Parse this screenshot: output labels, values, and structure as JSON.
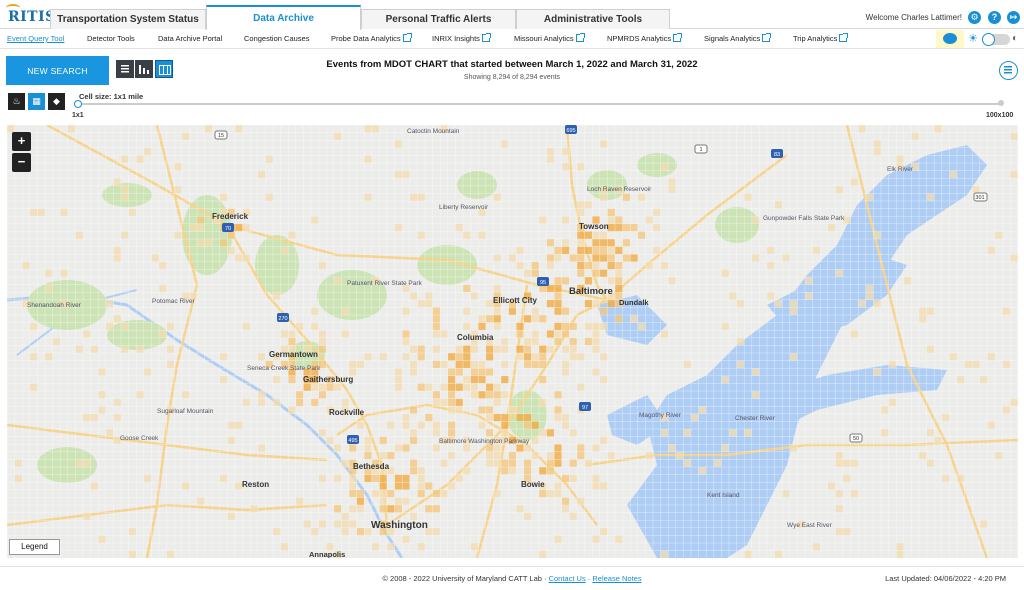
{
  "app": {
    "logo_text": "RITIS",
    "welcome": "Welcome Charles Lattimer!"
  },
  "tabs": [
    {
      "label": "Transportation System Status",
      "active": false
    },
    {
      "label": "Data Archive",
      "active": true
    },
    {
      "label": "Personal Traffic Alerts",
      "active": false
    },
    {
      "label": "Administrative Tools",
      "active": false
    }
  ],
  "header_icons": [
    "gear-icon",
    "help-icon",
    "logout-icon"
  ],
  "nav": [
    {
      "label": "Event Query Tool",
      "active": true,
      "external": false
    },
    {
      "label": "Detector Tools",
      "external": false
    },
    {
      "label": "Data Archive Portal",
      "external": false
    },
    {
      "label": "Congestion Causes",
      "external": false
    },
    {
      "label": "Probe Data Analytics",
      "external": true
    },
    {
      "label": "INRIX Insights",
      "external": true
    },
    {
      "label": "Missouri Analytics",
      "external": true
    },
    {
      "label": "NPMRDS Analytics",
      "external": true
    },
    {
      "label": "Signals Analytics",
      "external": true
    },
    {
      "label": "Trip Analytics",
      "external": true
    }
  ],
  "controls": {
    "new_search": "NEW SEARCH",
    "view_modes": [
      "list-view",
      "chart-view",
      "map-view"
    ],
    "active_view": "map-view",
    "layer_modes": [
      "heatmap-layer",
      "grid-layer",
      "marker-layer"
    ],
    "active_layer": "grid-layer"
  },
  "query": {
    "title": "Events from MDOT CHART that started between March 1, 2022 and March 31, 2022",
    "summary": "Showing 8,294 of 8,294 events"
  },
  "cell_size": {
    "label": "Cell size: 1x1 mile",
    "min": "1x1",
    "max": "100x100",
    "value": 0
  },
  "map": {
    "zoom_in": "+",
    "zoom_out": "−",
    "legend": "Legend",
    "place_labels": [
      "Frederick",
      "Baltimore",
      "Towson",
      "Dundalk",
      "Ellicott City",
      "Columbia",
      "Germantown",
      "Gaithersburg",
      "Rockville",
      "Bethesda",
      "Washington",
      "Reston",
      "Bowie",
      "Liberty Reservoir",
      "Patuxent River State Park",
      "Shenandoah River",
      "Potomac River",
      "Goose Creek",
      "Loch Raven Reservoir",
      "Gunpowder Falls State Park",
      "Elk River",
      "Chester River",
      "Magothy River",
      "Kent Island",
      "Wye East River",
      "Catoctin Mountain",
      "Baltimore Washington Parkway",
      "Sugarloaf Mountain",
      "Seneca Creek State Park",
      "Annapolis"
    ],
    "highway_shields": [
      "15",
      "70",
      "270",
      "95",
      "695",
      "83",
      "495",
      "97",
      "50",
      "301",
      "1"
    ],
    "colors": {
      "water": "#aecdf4",
      "land": "#ececea",
      "park": "#cce3b5",
      "highway": "#f7d28a",
      "cell_low": "#f3dcb0",
      "cell_mid": "#f4c57a",
      "cell_high": "#f0a83c",
      "grid": "#ffffff"
    }
  },
  "footer": {
    "copyright": "© 2008 - 2022 University of Maryland CATT Lab",
    "contact": "Contact Us",
    "release": "Release Notes",
    "updated": "Last Updated: 04/06/2022 - 4:20 PM"
  }
}
